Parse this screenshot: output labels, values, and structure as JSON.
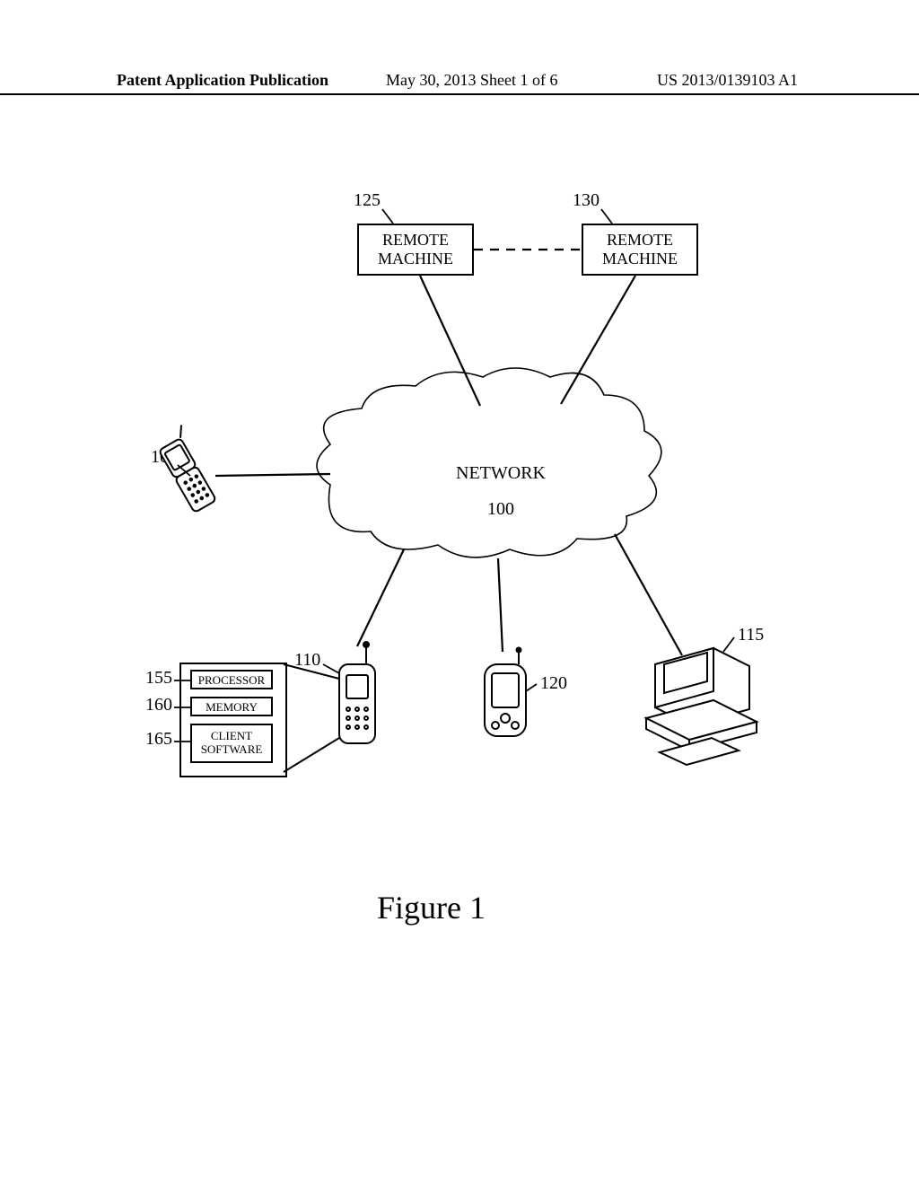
{
  "header": {
    "left": "Patent Application Publication",
    "center": "May 30, 2013  Sheet 1 of 6",
    "right": "US 2013/0139103 A1"
  },
  "boxes": {
    "remote1": "REMOTE\nMACHINE",
    "remote2": "REMOTE\nMACHINE"
  },
  "network": {
    "label": "NETWORK",
    "num": "100"
  },
  "components": {
    "processor": "PROCESSOR",
    "memory": "MEMORY",
    "client": "CLIENT\nSOFTWARE"
  },
  "refs": {
    "r125": "125",
    "r130": "130",
    "r105": "105",
    "r110": "110",
    "r115": "115",
    "r120": "120",
    "r155": "155",
    "r160": "160",
    "r165": "165"
  },
  "caption": "Figure 1",
  "chart_data": {
    "type": "diagram",
    "title": "Figure 1",
    "nodes": [
      {
        "id": "100",
        "label": "NETWORK",
        "type": "cloud"
      },
      {
        "id": "105",
        "label": "flip phone",
        "type": "client-device"
      },
      {
        "id": "110",
        "label": "mobile phone with antenna",
        "type": "client-device",
        "sub_components": [
          {
            "id": "155",
            "label": "PROCESSOR"
          },
          {
            "id": "160",
            "label": "MEMORY"
          },
          {
            "id": "165",
            "label": "CLIENT SOFTWARE"
          }
        ]
      },
      {
        "id": "115",
        "label": "desktop computer with keyboard",
        "type": "client-device"
      },
      {
        "id": "120",
        "label": "PDA / handheld",
        "type": "client-device"
      },
      {
        "id": "125",
        "label": "REMOTE MACHINE",
        "type": "server"
      },
      {
        "id": "130",
        "label": "REMOTE MACHINE",
        "type": "server"
      }
    ],
    "edges": [
      {
        "from": "125",
        "to": "100",
        "style": "solid"
      },
      {
        "from": "130",
        "to": "100",
        "style": "solid"
      },
      {
        "from": "125",
        "to": "130",
        "style": "dashed"
      },
      {
        "from": "105",
        "to": "100",
        "style": "solid"
      },
      {
        "from": "110",
        "to": "100",
        "style": "solid"
      },
      {
        "from": "115",
        "to": "100",
        "style": "solid"
      },
      {
        "from": "120",
        "to": "100",
        "style": "solid"
      }
    ]
  }
}
